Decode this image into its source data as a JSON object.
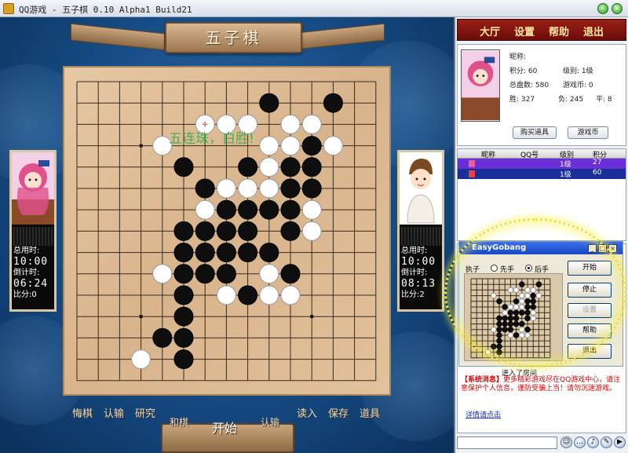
{
  "window": {
    "title": "QQ游戏 - 五子棋   0.10  Alpha1  Build21",
    "min_label": "–",
    "close_label": "×"
  },
  "game": {
    "banner_title": "五子棋",
    "win_message": "五连珠，白胜!",
    "board_size": 15,
    "star_points": [
      [
        3,
        3
      ],
      [
        3,
        11
      ],
      [
        11,
        3
      ],
      [
        11,
        11
      ]
    ],
    "black_stones": [
      [
        9,
        1
      ],
      [
        12,
        1
      ],
      [
        11,
        3
      ],
      [
        11,
        4
      ],
      [
        5,
        4
      ],
      [
        8,
        4
      ],
      [
        10,
        4
      ],
      [
        11,
        4
      ],
      [
        6,
        5
      ],
      [
        10,
        5
      ],
      [
        11,
        5
      ],
      [
        7,
        6
      ],
      [
        8,
        6
      ],
      [
        9,
        6
      ],
      [
        10,
        6
      ],
      [
        5,
        7
      ],
      [
        6,
        7
      ],
      [
        7,
        7
      ],
      [
        8,
        7
      ],
      [
        10,
        7
      ],
      [
        5,
        8
      ],
      [
        6,
        8
      ],
      [
        7,
        8
      ],
      [
        8,
        8
      ],
      [
        9,
        8
      ],
      [
        5,
        9
      ],
      [
        6,
        9
      ],
      [
        7,
        9
      ],
      [
        10,
        9
      ],
      [
        8,
        10
      ],
      [
        5,
        10
      ],
      [
        5,
        11
      ],
      [
        4,
        12
      ],
      [
        5,
        12
      ],
      [
        5,
        13
      ]
    ],
    "white_stones": [
      [
        7,
        2
      ],
      [
        8,
        2
      ],
      [
        10,
        2
      ],
      [
        11,
        2
      ],
      [
        4,
        3
      ],
      [
        9,
        3
      ],
      [
        10,
        3
      ],
      [
        12,
        3
      ],
      [
        9,
        4
      ],
      [
        7,
        5
      ],
      [
        8,
        5
      ],
      [
        9,
        5
      ],
      [
        11,
        5
      ],
      [
        11,
        6
      ],
      [
        6,
        6
      ],
      [
        5,
        7
      ],
      [
        11,
        7
      ],
      [
        9,
        8
      ],
      [
        4,
        9
      ],
      [
        9,
        9
      ],
      [
        7,
        10
      ],
      [
        9,
        10
      ],
      [
        10,
        10
      ],
      [
        3,
        13
      ]
    ],
    "last_move_marker": [
      6,
      2
    ],
    "left_player": {
      "total_time_label": "总用时:",
      "total_time": "10:00",
      "countdown_label": "倒计时:",
      "countdown": "06:24",
      "score_label": "比分:0"
    },
    "right_player": {
      "total_time_label": "总用时:",
      "total_time": "10:00",
      "countdown_label": "倒计时:",
      "countdown": "08:13",
      "score_label": "比分:2"
    },
    "bottom_buttons": {
      "regret": "悔棋",
      "lose": "认输",
      "study": "研究",
      "draw": "和棋",
      "start": "开始",
      "resign": "认输",
      "load": "读入",
      "save": "保存",
      "tools": "道具"
    }
  },
  "sidebar": {
    "menu": [
      "大厅",
      "设置",
      "帮助",
      "退出"
    ],
    "profile": {
      "nickname_label": "昵称:",
      "score_label": "积分: 60",
      "level_label": "级别: 1级",
      "total_games": "总盘数: 580",
      "coins": "游戏币: 0",
      "wins": "胜: 327",
      "losses": "负: 245",
      "draws": "平: 8",
      "buy_button": "购买道具",
      "coin_button": "游戏币"
    },
    "user_list": {
      "headers": [
        "昵称",
        "QQ号",
        "级别",
        "积分"
      ],
      "rows": [
        {
          "level": "1级",
          "score": "27"
        },
        {
          "level": "1级",
          "score": "60"
        }
      ]
    },
    "chat": {
      "joined_text": "进入了房间",
      "system_label": "【系统消息】",
      "system_text": "更多精彩游戏尽在QQ游戏中心，请注意保护个人信息，谨防受骗上当！请勿沉迷游戏。",
      "detail_link": "详情请点击"
    }
  },
  "dialog": {
    "title": "EasyGobang",
    "order_label": "执子",
    "first_label": "先手",
    "second_label": "后手",
    "selected": "后手",
    "buttons": [
      "开始",
      "停止",
      "设置",
      "帮助",
      "退出"
    ],
    "disabled": [
      "设置"
    ]
  },
  "colors": {
    "board": "#dcb88e",
    "menu_bg": "#8a1810",
    "menu_text": "#ffe6a0",
    "win_text": "#4caf50",
    "highlight_row": "#6b2fd8"
  }
}
